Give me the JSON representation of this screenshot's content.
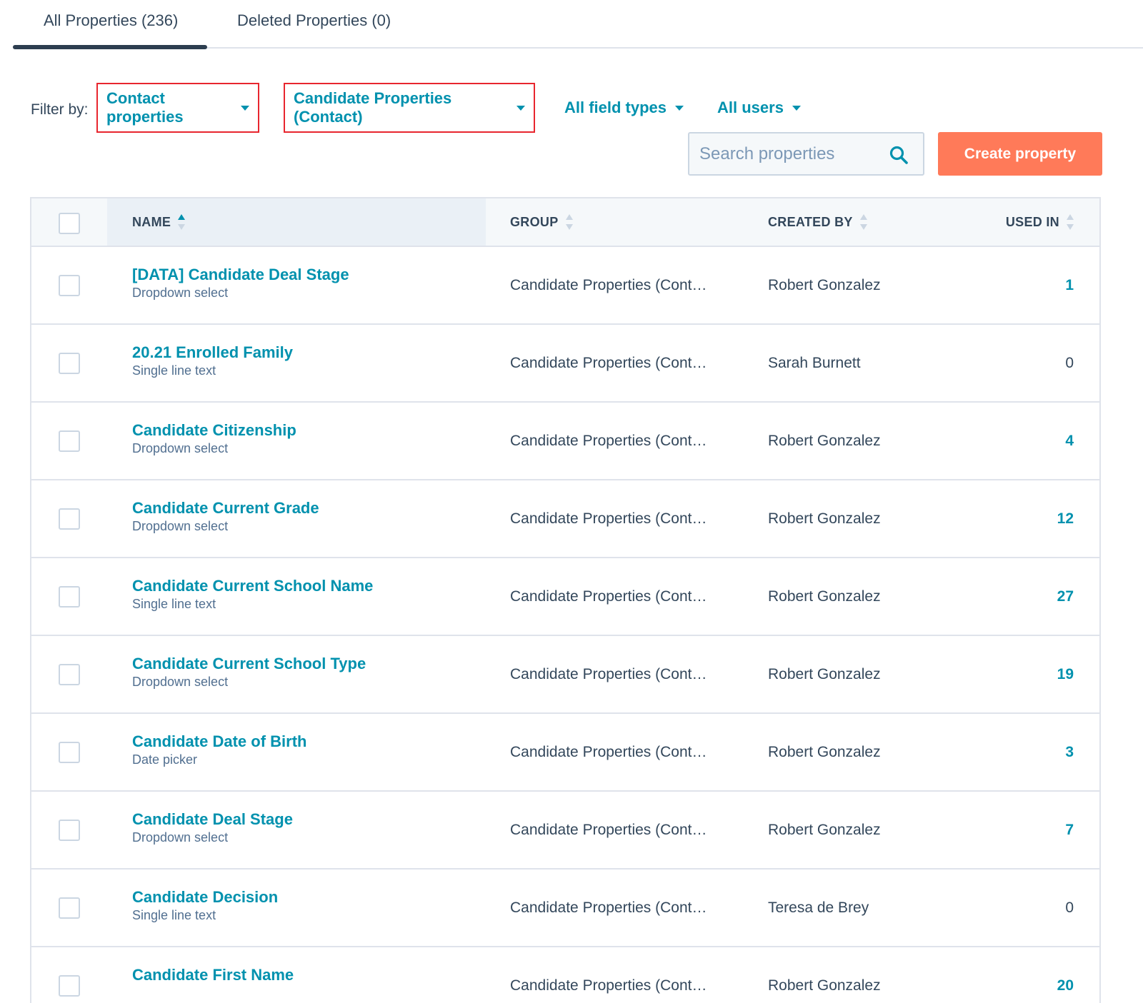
{
  "tabs": [
    {
      "label": "All Properties (236)"
    },
    {
      "label": "Deleted Properties (0)"
    }
  ],
  "filters": {
    "label": "Filter by:",
    "object": "Contact properties",
    "group": "Candidate Properties (Contact)",
    "field_types": "All field types",
    "users": "All users"
  },
  "search": {
    "placeholder": "Search properties"
  },
  "create_label": "Create property",
  "table": {
    "headers": {
      "name": "NAME",
      "group": "GROUP",
      "created_by": "CREATED BY",
      "used_in": "USED IN"
    },
    "rows": [
      {
        "name": "[DATA] Candidate Deal Stage",
        "type": "Dropdown select",
        "group": "Candidate Properties (Cont…",
        "created_by": "Robert Gonzalez",
        "used_in": "1"
      },
      {
        "name": "20.21 Enrolled Family",
        "type": "Single line text",
        "group": "Candidate Properties (Cont…",
        "created_by": "Sarah Burnett",
        "used_in": "0"
      },
      {
        "name": "Candidate Citizenship",
        "type": "Dropdown select",
        "group": "Candidate Properties (Cont…",
        "created_by": "Robert Gonzalez",
        "used_in": "4"
      },
      {
        "name": "Candidate Current Grade",
        "type": "Dropdown select",
        "group": "Candidate Properties (Cont…",
        "created_by": "Robert Gonzalez",
        "used_in": "12"
      },
      {
        "name": "Candidate Current School Name",
        "type": "Single line text",
        "group": "Candidate Properties (Cont…",
        "created_by": "Robert Gonzalez",
        "used_in": "27"
      },
      {
        "name": "Candidate Current School Type",
        "type": "Dropdown select",
        "group": "Candidate Properties (Cont…",
        "created_by": "Robert Gonzalez",
        "used_in": "19"
      },
      {
        "name": "Candidate Date of Birth",
        "type": "Date picker",
        "group": "Candidate Properties (Cont…",
        "created_by": "Robert Gonzalez",
        "used_in": "3"
      },
      {
        "name": "Candidate Deal Stage",
        "type": "Dropdown select",
        "group": "Candidate Properties (Cont…",
        "created_by": "Robert Gonzalez",
        "used_in": "7"
      },
      {
        "name": "Candidate Decision",
        "type": "Single line text",
        "group": "Candidate Properties (Cont…",
        "created_by": "Teresa de Brey",
        "used_in": "0"
      },
      {
        "name": "Candidate First Name",
        "type": "",
        "group": "Candidate Properties (Cont…",
        "created_by": "Robert Gonzalez",
        "used_in": "20"
      }
    ]
  },
  "colors": {
    "link": "#0091ae",
    "accent": "#ff7a59",
    "highlight_box": "#e8262e"
  }
}
